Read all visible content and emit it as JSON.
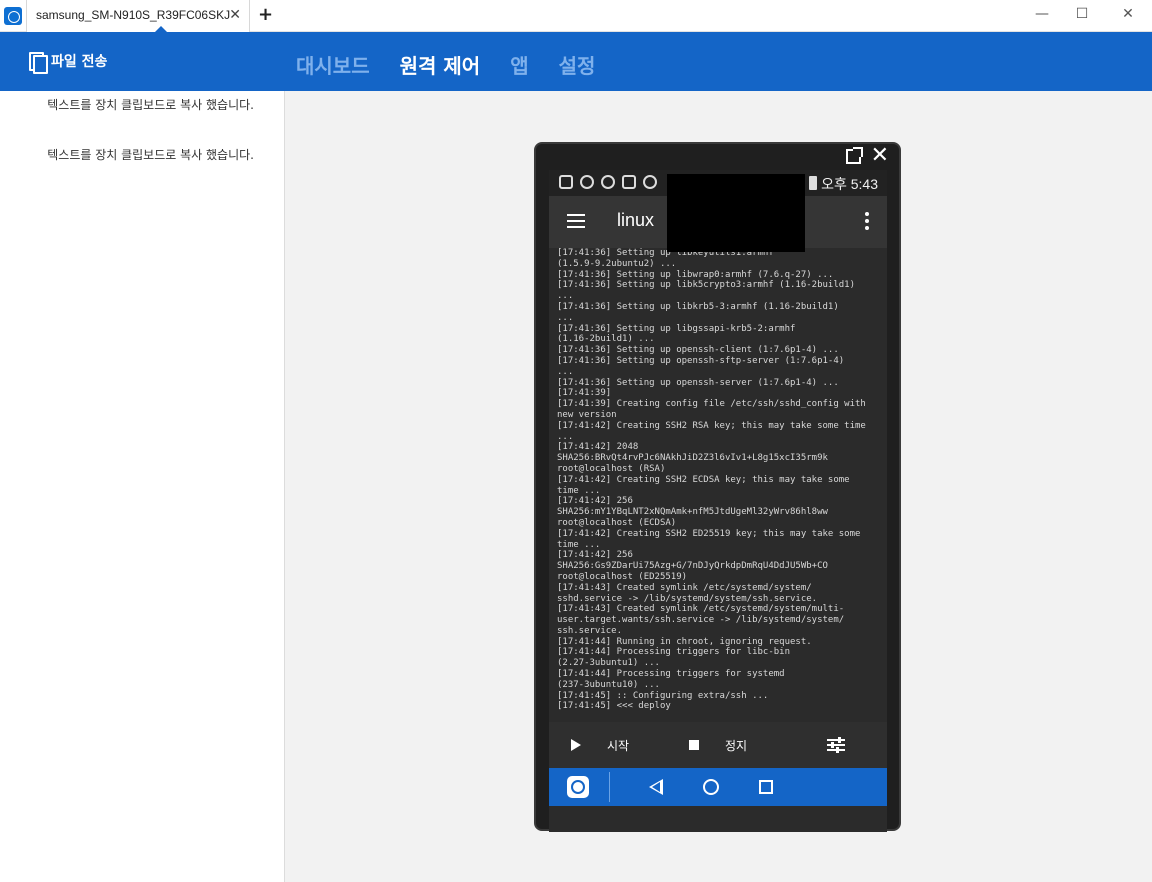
{
  "titlebar": {
    "tab_label": "samsung_SM-N910S_R39FC06SKJ",
    "tab_close": "✕",
    "tab_add": "+",
    "minimize": "—",
    "maximize": "☐",
    "close": "✕"
  },
  "header": {
    "file_transfer_label": "파일 전송",
    "nav": [
      "대시보드",
      "원격 제어",
      "앱",
      "설정"
    ],
    "active_nav": "원격 제어"
  },
  "sidebar": {
    "messages": [
      "텍스트를 장치 클립보드로 복사 했습니다.",
      "텍스트를 장치 클립보드로 복사 했습니다."
    ]
  },
  "phone": {
    "close_glyph": "✕",
    "status_time": "오후 5:43",
    "app_title": "linux",
    "terminal_text": "[17:41:36] Setting up libkeyutils1:armhf\n(1.5.9-9.2ubuntu2) ...\n[17:41:36] Setting up libwrap0:armhf (7.6.q-27) ...\n[17:41:36] Setting up libk5crypto3:armhf (1.16-2build1)\n...\n[17:41:36] Setting up libkrb5-3:armhf (1.16-2build1)\n...\n[17:41:36] Setting up libgssapi-krb5-2:armhf\n(1.16-2build1) ...\n[17:41:36] Setting up openssh-client (1:7.6p1-4) ...\n[17:41:36] Setting up openssh-sftp-server (1:7.6p1-4)\n...\n[17:41:36] Setting up openssh-server (1:7.6p1-4) ...\n[17:41:39]\n[17:41:39] Creating config file /etc/ssh/sshd_config with\nnew version\n[17:41:42] Creating SSH2 RSA key; this may take some time\n...\n[17:41:42] 2048\nSHA256:BRvQt4rvPJc6NAkhJiD2Z3l6vIv1+L8g15xcI35rm9k\nroot@localhost (RSA)\n[17:41:42] Creating SSH2 ECDSA key; this may take some\ntime ...\n[17:41:42] 256\nSHA256:mY1YBqLNT2xNQmAmk+nfM5JtdUgeMl32yWrv86hl8ww\nroot@localhost (ECDSA)\n[17:41:42] Creating SSH2 ED25519 key; this may take some\ntime ...\n[17:41:42] 256\nSHA256:Gs9ZDarUi75Azg+G/7nDJyQrkdpDmRqU4DdJU5Wb+CO\nroot@localhost (ED25519)\n[17:41:43] Created symlink /etc/systemd/system/\nsshd.service -> /lib/systemd/system/ssh.service.\n[17:41:43] Created symlink /etc/systemd/system/multi-\nuser.target.wants/ssh.service -> /lib/systemd/system/\nssh.service.\n[17:41:44] Running in chroot, ignoring request.\n[17:41:44] Processing triggers for libc-bin\n(2.27-3ubuntu1) ...\n[17:41:44] Processing triggers for systemd\n(237-3ubuntu10) ...\n[17:41:45] :: Configuring extra/ssh ...\n[17:41:45] <<< deploy",
    "start_label": "시작",
    "stop_label": "정지"
  }
}
